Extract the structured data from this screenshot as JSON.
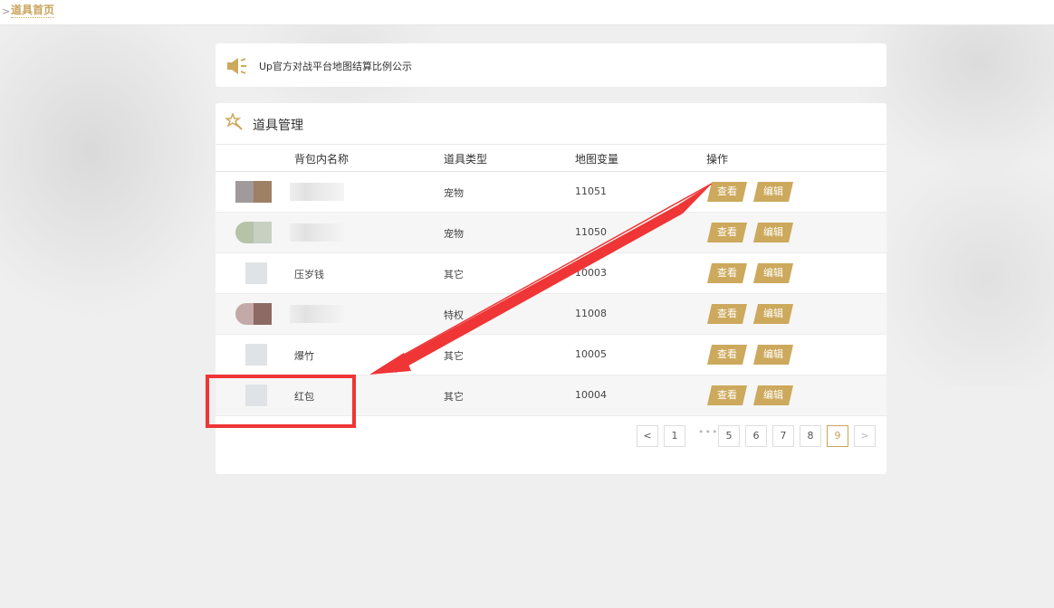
{
  "breadcrumb": {
    "separator": ">",
    "current": "道具首页"
  },
  "notice": {
    "icon": "speaker-icon",
    "text": "Up官方对战平台地图结算比例公示"
  },
  "panel": {
    "icon": "magic-wand-icon",
    "title": "道具管理",
    "columns": [
      "背包内名称",
      "道具类型",
      "地图变量",
      "操作"
    ],
    "rows": [
      {
        "name": "",
        "type": "宠物",
        "variable": "11051",
        "view": "查看",
        "edit": "编辑"
      },
      {
        "name": "",
        "type": "宠物",
        "variable": "11050",
        "view": "查看",
        "edit": "编辑"
      },
      {
        "name": "压岁钱",
        "type": "其它",
        "variable": "10003",
        "view": "查看",
        "edit": "编辑"
      },
      {
        "name": "",
        "type": "特权",
        "variable": "11008",
        "view": "查看",
        "edit": "编辑"
      },
      {
        "name": "爆竹",
        "type": "其它",
        "variable": "10005",
        "view": "查看",
        "edit": "编辑"
      },
      {
        "name": "红包",
        "type": "其它",
        "variable": "10004",
        "view": "查看",
        "edit": "编辑"
      }
    ]
  },
  "pagination": {
    "prev": "<",
    "first": "1",
    "ellipsis": "•••",
    "pages": [
      "5",
      "6",
      "7",
      "8",
      "9"
    ],
    "current": "9",
    "next": ">"
  },
  "colors": {
    "accent": "#cca95c",
    "annotation": "#ef3535"
  }
}
